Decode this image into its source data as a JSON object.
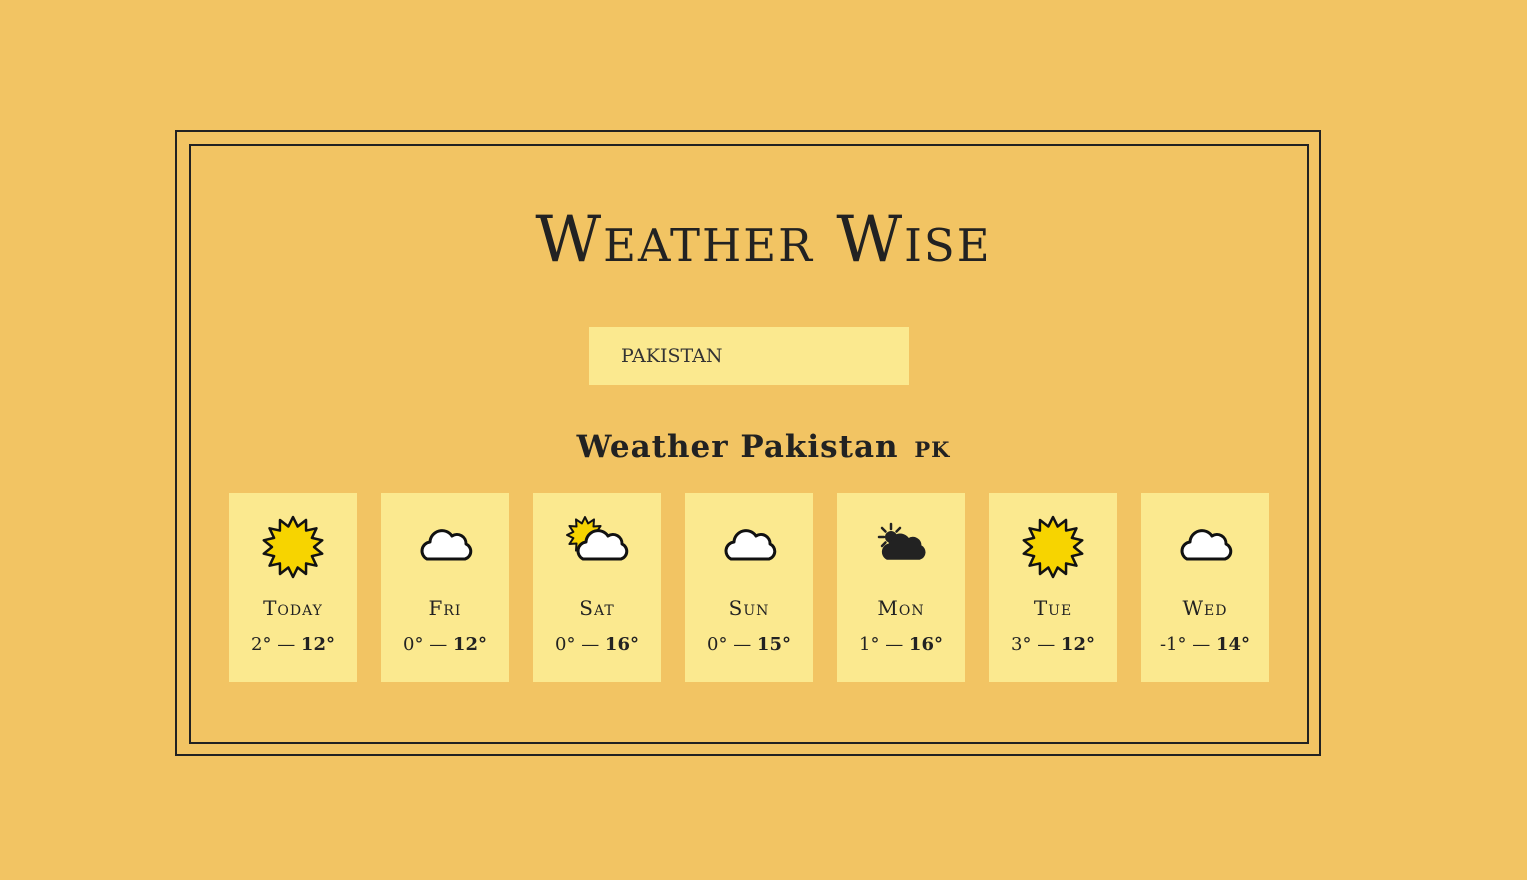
{
  "app": {
    "title": "Weather Wise"
  },
  "search": {
    "value": "PAKISTAN"
  },
  "location": {
    "heading": "Weather Pakistan",
    "country_code": "PK"
  },
  "temp_separator": " — ",
  "forecast": [
    {
      "day": "Today",
      "icon": "sun-icon",
      "min": "2°",
      "max": "12°"
    },
    {
      "day": "Fri",
      "icon": "cloud-icon",
      "min": "0°",
      "max": "12°"
    },
    {
      "day": "Sat",
      "icon": "partly-cloudy-icon",
      "min": "0°",
      "max": "16°"
    },
    {
      "day": "Sun",
      "icon": "cloud-icon",
      "min": "0°",
      "max": "15°"
    },
    {
      "day": "Mon",
      "icon": "partly-cloudy-dark-icon",
      "min": "1°",
      "max": "16°"
    },
    {
      "day": "Tue",
      "icon": "sun-icon",
      "min": "3°",
      "max": "12°"
    },
    {
      "day": "Wed",
      "icon": "cloud-icon",
      "min": "-1°",
      "max": "14°"
    }
  ],
  "colors": {
    "background": "#f2c463",
    "card": "#fbe98f",
    "text": "#222222",
    "sun": "#f7d400"
  }
}
